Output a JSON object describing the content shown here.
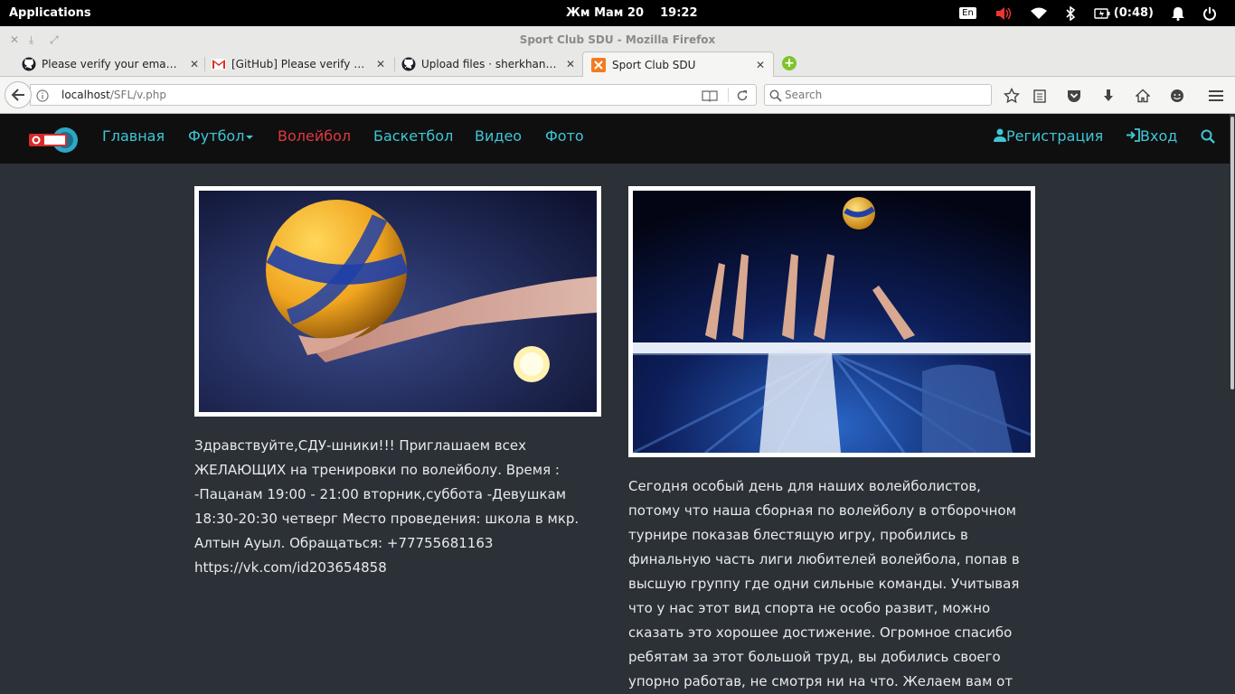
{
  "system_bar": {
    "applications_label": "Applications",
    "clock": "Жм Мам 20    19:22",
    "keyboard_layout": "En",
    "battery": "(0:48)"
  },
  "window": {
    "title": "Sport Club SDU - Mozilla Firefox"
  },
  "tabs": [
    {
      "label": "Please verify your email ad...",
      "icon": "github-icon"
    },
    {
      "label": "[GitHub] Please verify your...",
      "icon": "gmail-icon"
    },
    {
      "label": "Upload files · sherkhancrs/...",
      "icon": "github-icon"
    },
    {
      "label": "Sport Club SDU",
      "icon": "xampp-icon",
      "active": true
    }
  ],
  "navigation": {
    "url_host": "localhost",
    "url_path": "/SFL/v.php",
    "search_placeholder": "Search"
  },
  "site": {
    "menu": [
      {
        "label": "Главная"
      },
      {
        "label": "Футбол"
      },
      {
        "label": "Волейбол",
        "active": true
      },
      {
        "label": "Баскетбол"
      },
      {
        "label": "Видео"
      },
      {
        "label": "Фото"
      }
    ],
    "register_label": "Регистрация",
    "login_label": "Вход",
    "colors": {
      "menu_link": "#3fc6d6",
      "menu_active": "#e2383d",
      "page_bg": "#2b3137",
      "nav_bg": "#0f0f10"
    }
  },
  "posts": [
    {
      "image_alt": "volleyball in hand",
      "lines": [
        "Здравствуйте,СДУ-шники!!! Приглашаем всех",
        "ЖЕЛАЮЩИХ на тренировки по волейболу. Время :",
        "-Пацанам 19:00 - 21:00 вторник,суббота -Девушкам",
        "18:30-20:30 четверг Место проведения: школа в мкр.",
        "Алтын Ауыл. Обращаться: +77755681163",
        "https://vk.com/id203654858"
      ]
    },
    {
      "image_alt": "volleyball block at the net",
      "lines": [
        "Сегодня особый день для наших волейболистов,",
        "потому что наша сборная по волейболу в отборочном",
        "турнире показав блестящую игру, пробились в",
        "финальную часть лиги любителей волейбола, попав в",
        "высшую группу где одни сильные команды. Учитывая",
        "что у нас этот вид спорта не особо развит, можно",
        "сказать это хорошее достижение. Огромное спасибо",
        "ребятам за этот большой труд, вы добились своего",
        "упорно работав, не смотря ни на что. Желаем вам от"
      ]
    }
  ]
}
